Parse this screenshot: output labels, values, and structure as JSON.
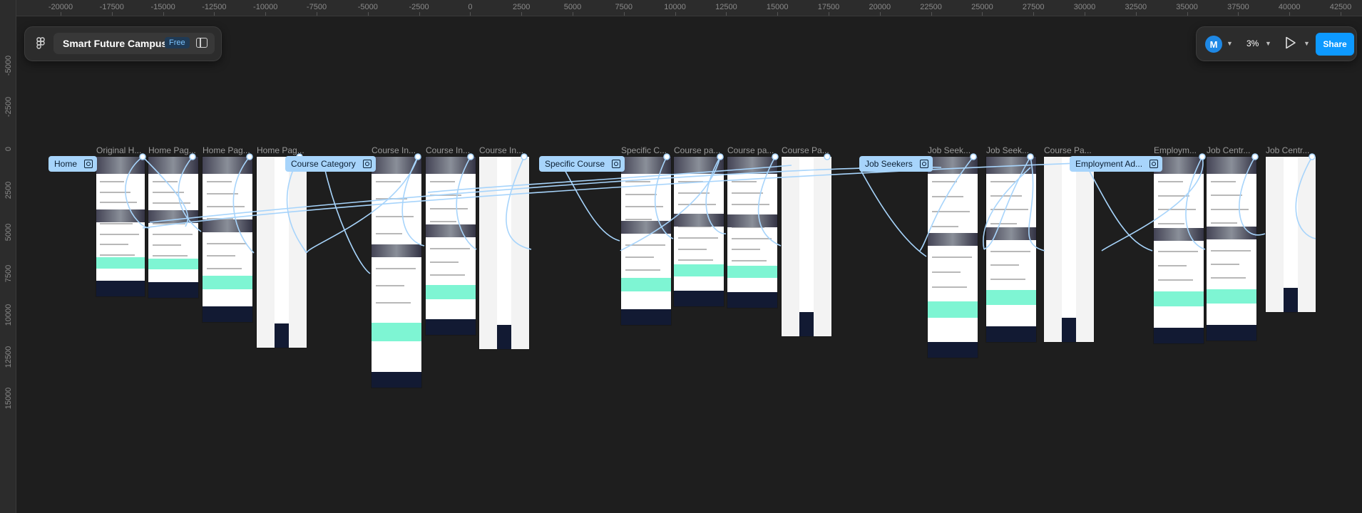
{
  "project": {
    "name": "Smart Future Campus",
    "plan_badge": "Free"
  },
  "toolbar": {
    "avatar_initial": "M",
    "zoom": "3%",
    "share_label": "Share"
  },
  "ruler": {
    "x_labels": [
      "-20000",
      "-17500",
      "-15000",
      "-12500",
      "-10000",
      "-7500",
      "-5000",
      "-2500",
      "0",
      "2500",
      "5000",
      "7500",
      "10000",
      "12500",
      "15000",
      "17500",
      "20000",
      "22500",
      "25000",
      "27500",
      "30000",
      "32500",
      "35000",
      "37500",
      "40000",
      "42500"
    ],
    "y_labels": [
      "-5000",
      "-2500",
      "0",
      "2500",
      "5000",
      "7500",
      "10000",
      "12500",
      "15000"
    ]
  },
  "sections": [
    "Home",
    "Course Category",
    "Specific Course",
    "Job Seekers",
    "Employment Ad..."
  ],
  "frames": [
    "Original H...",
    "Home Pag...",
    "Home Pag...",
    "Home Pag...",
    "Course In...",
    "Course In...",
    "Course In...",
    "Specific C...",
    "Course pa...",
    "Course pa...",
    "Course Pa...",
    "Job Seek...",
    "Job Seek...",
    "Course Pa...",
    "Employm...",
    "Job Centr...",
    "Job Centr..."
  ],
  "colors": {
    "accent": "#0d99ff",
    "section_pill": "#a7d4fb",
    "connector": "#a7d4fb",
    "canvas": "#1e1e1e",
    "mint": "#7ef5d3",
    "footer": "#121a33"
  }
}
